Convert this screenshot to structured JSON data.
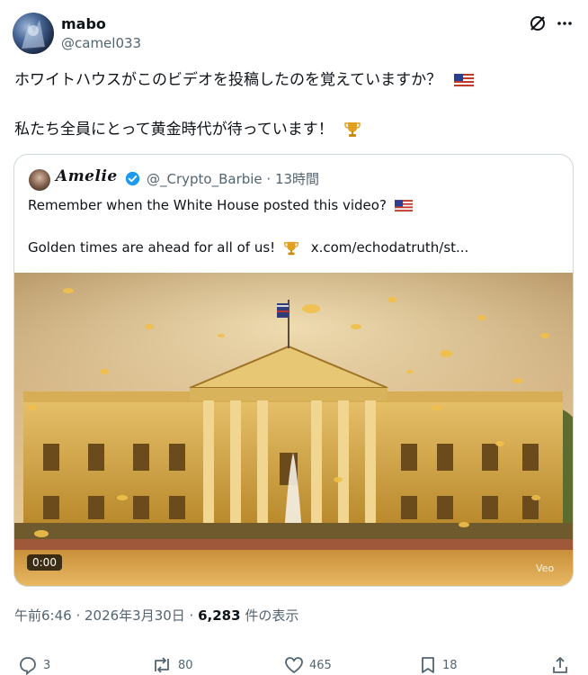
{
  "author": {
    "name": "mabo",
    "handle": "@camel033"
  },
  "post": {
    "line1": "ホワイトハウスがこのビデオを投稿したのを覚えていますか？",
    "line2": "私たち全員にとって黄金時代が待っています！"
  },
  "quote": {
    "name": "Amelie",
    "handle_time": "@_Crypto_Barbie · 13時間",
    "line1": "Remember when the White House posted this video?",
    "line2": "Golden times are ahead for all of us!",
    "link": "x.com/echodatruth/st...",
    "video_time": "0:00",
    "watermark": "Veo"
  },
  "meta": {
    "time": "午前6:46 · 2026年3月30日 · ",
    "views_count": "6,283",
    "views_label": " 件の表示"
  },
  "actions": {
    "replies": "3",
    "reposts": "80",
    "likes": "465",
    "bookmarks": "18"
  },
  "colors": {
    "verified": "#1d9bf0",
    "secondary_text": "#536471",
    "border": "#cfd9de"
  }
}
